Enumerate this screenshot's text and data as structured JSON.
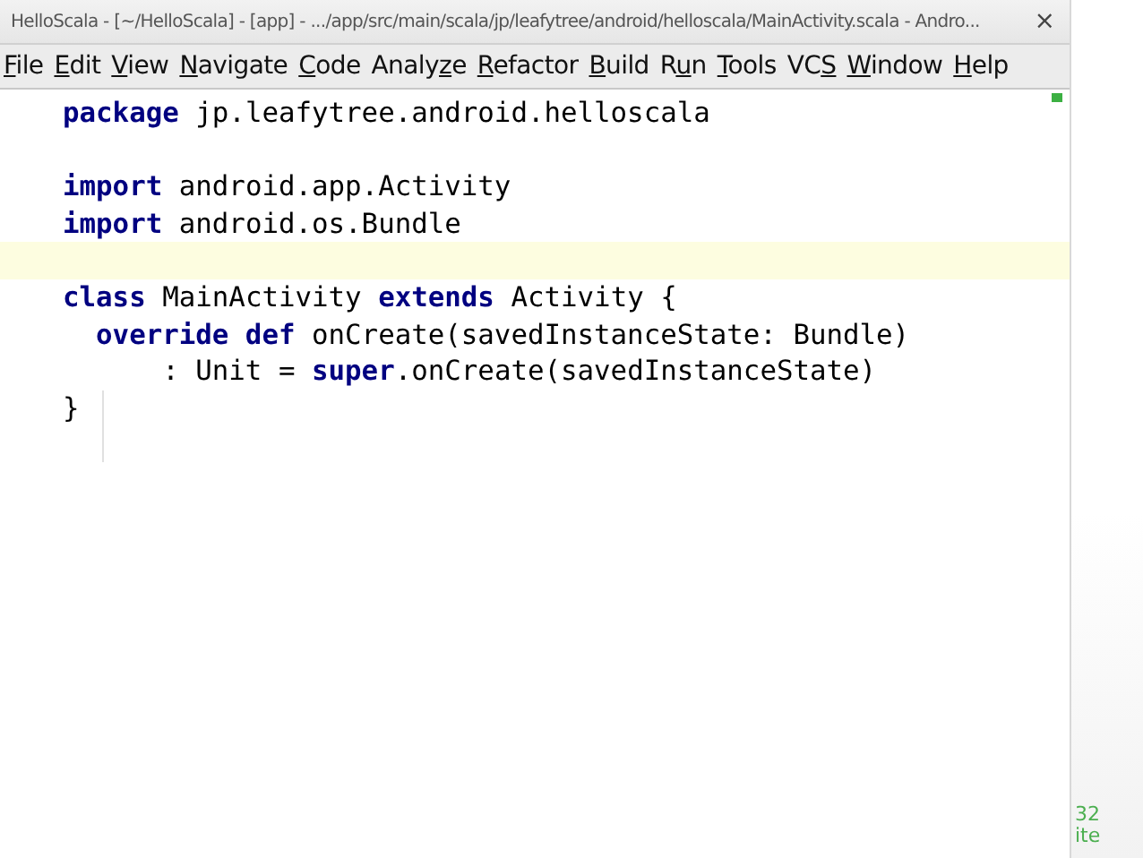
{
  "window": {
    "title": "HelloScala - [~/HelloScala] - [app] - .../app/src/main/scala/jp/leafytree/android/helloscala/MainActivity.scala - Andro...",
    "close": "×"
  },
  "menu": [
    {
      "mnemonic": "F",
      "after": "ile"
    },
    {
      "mnemonic": "E",
      "after": "dit"
    },
    {
      "mnemonic": "V",
      "after": "iew"
    },
    {
      "mnemonic": "N",
      "after": "avigate"
    },
    {
      "mnemonic": "C",
      "after": "ode"
    },
    {
      "before": "Analy",
      "mnemonic": "z",
      "after": "e"
    },
    {
      "mnemonic": "R",
      "after": "efactor"
    },
    {
      "mnemonic": "B",
      "after": "uild"
    },
    {
      "before": "R",
      "mnemonic": "u",
      "after": "n"
    },
    {
      "mnemonic": "T",
      "after": "ools"
    },
    {
      "before": "VC",
      "mnemonic": "S"
    },
    {
      "mnemonic": "W",
      "after": "indow"
    },
    {
      "mnemonic": "H",
      "after": "elp"
    }
  ],
  "editor": {
    "lines": [
      {
        "current": false,
        "tokens": [
          {
            "kind": "keyword",
            "text": "package"
          },
          {
            "kind": "plain",
            "text": " jp.leafytree.android.helloscala"
          }
        ]
      },
      {
        "current": false
      },
      {
        "current": false,
        "tokens": [
          {
            "kind": "keyword",
            "text": "import"
          },
          {
            "kind": "plain",
            "text": " android.app.Activity"
          }
        ]
      },
      {
        "current": false,
        "tokens": [
          {
            "kind": "keyword",
            "text": "import"
          },
          {
            "kind": "plain",
            "text": " android.os.Bundle"
          }
        ]
      },
      {
        "current": true
      },
      {
        "current": false,
        "tokens": [
          {
            "kind": "keyword",
            "text": "class"
          },
          {
            "kind": "plain",
            "text": " MainActivity "
          },
          {
            "kind": "keyword",
            "text": "extends"
          },
          {
            "kind": "plain",
            "text": " Activity {"
          }
        ]
      },
      {
        "current": false,
        "tokens": [
          {
            "kind": "keyword",
            "text": "  override def"
          },
          {
            "kind": "plain",
            "text": " onCreate(savedInstanceState: Bundle)"
          }
        ]
      },
      {
        "current": false,
        "tokens": [
          {
            "kind": "plain",
            "text": "      : Unit = "
          },
          {
            "kind": "keyword",
            "text": "super"
          },
          {
            "kind": "plain",
            "text": ".onCreate(savedInstanceState)"
          }
        ]
      },
      {
        "current": false,
        "tokens": [
          {
            "kind": "plain",
            "text": "}"
          }
        ]
      }
    ]
  },
  "slide_footer": {
    "page_number": "32",
    "fragment": "ite"
  }
}
